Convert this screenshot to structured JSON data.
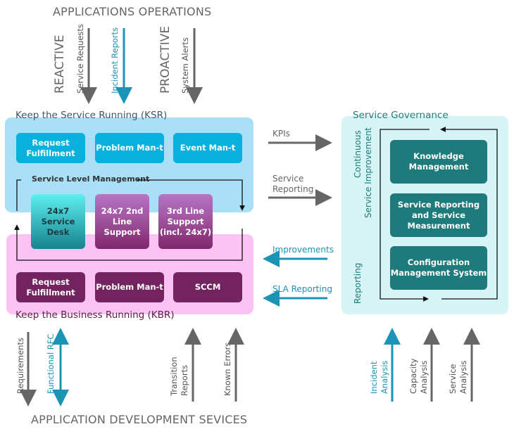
{
  "top": {
    "title": "APPLICATIONS OPERATIONS",
    "reactive_label": "REACTIVE",
    "proactive_label": "PROACTIVE",
    "arrows": [
      {
        "label": "Service Requests",
        "direction": "down",
        "color": "#555555"
      },
      {
        "label": "Incident Reports",
        "direction": "down",
        "color": "#1b93b5"
      },
      {
        "label": "System Alerts",
        "direction": "down",
        "color": "#555555"
      }
    ]
  },
  "ksr": {
    "title": "Keep the Service Running (KSR)",
    "boxes": [
      "Request Fulfillment",
      "Problem Man-t",
      "Event Man-t"
    ],
    "slm_label": "Service Level Management"
  },
  "shared": {
    "boxes": [
      "24x7 Service Desk",
      "24x7 2nd Line Support",
      "3rd Line Support (incl. 24x7)"
    ]
  },
  "kbr": {
    "title": "Keep the Business Running (KBR)",
    "boxes": [
      "Request Fulfillment",
      "Problem Man-t",
      "SCCM"
    ]
  },
  "middle": {
    "flows": [
      {
        "label": "KPIs",
        "direction": "right",
        "color": "#666666"
      },
      {
        "label": "Service Reporting",
        "direction": "right",
        "color": "#666666"
      },
      {
        "label": "Improvements",
        "direction": "left",
        "color": "#1b93b5"
      },
      {
        "label": "SLA Reporting",
        "direction": "left",
        "color": "#1b93b5"
      }
    ]
  },
  "governance": {
    "title": "Service Governance",
    "side_label_top_1": "Continuous",
    "side_label_top_2": "Service Improvement",
    "side_label_bottom": "Reporting",
    "boxes": [
      "Knowledge Management",
      "Service Reporting and Service Measurement",
      "Configuration Management System"
    ]
  },
  "bottom": {
    "title": "APPLICATION DEVELOPMENT SEVICES",
    "arrows": [
      {
        "label": "Requirements",
        "direction": "down",
        "color": "#555555"
      },
      {
        "label": "Functional RFC",
        "direction": "both",
        "color": "#1b93b5"
      },
      {
        "label_1": "Transition",
        "label_2": "Reports",
        "direction": "up",
        "color": "#555555"
      },
      {
        "label": "Known Errors",
        "direction": "up",
        "color": "#555555"
      },
      {
        "label_1": "Incident",
        "label_2": "Analysis",
        "direction": "up",
        "color": "#1b93b5"
      },
      {
        "label_1": "Capacity",
        "label_2": "Analysis",
        "direction": "up",
        "color": "#555555"
      },
      {
        "label_1": "Service",
        "label_2": "Analysis",
        "direction": "up",
        "color": "#555555"
      }
    ]
  },
  "colors": {
    "ksr_panel": "#a9dff7",
    "ksr_box": "#06b1de",
    "kbr_panel": "#fcc2f4",
    "kbr_box": "#732360",
    "governance_panel": "#d6f3f6",
    "governance_box": "#1f7b7b",
    "teal_accent": "#1b93b5",
    "gray": "#666666"
  }
}
